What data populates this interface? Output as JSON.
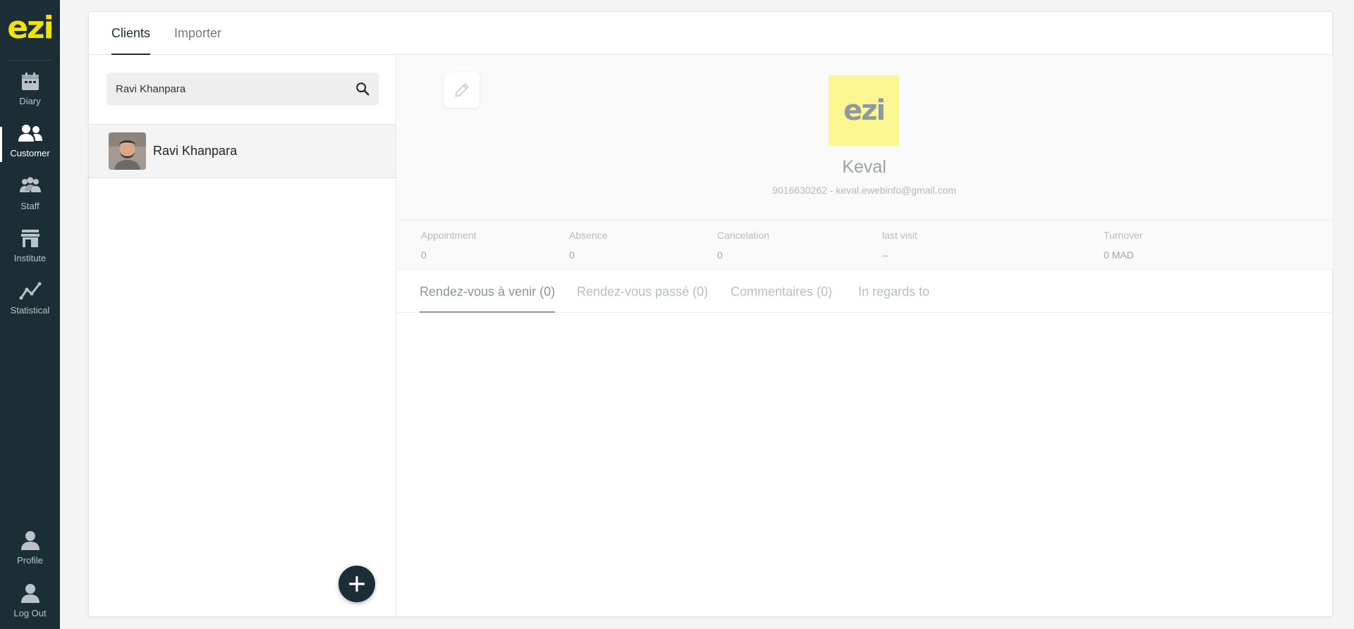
{
  "brand": {
    "logo_text": "ezi",
    "accent": "#f2e300",
    "sidebar_bg": "#1b2e36"
  },
  "sidebar": {
    "items": [
      {
        "label": "Diary",
        "icon": "calendar-icon"
      },
      {
        "label": "Customer",
        "icon": "users-icon",
        "active": true
      },
      {
        "label": "Staff",
        "icon": "staff-icon"
      },
      {
        "label": "Institute",
        "icon": "store-icon"
      },
      {
        "label": "Statistical",
        "icon": "chart-line-icon"
      }
    ],
    "bottom_items": [
      {
        "label": "Profile",
        "icon": "user-icon"
      },
      {
        "label": "Log Out",
        "icon": "logout-user-icon"
      }
    ]
  },
  "top_tabs": [
    {
      "label": "Clients",
      "active": true
    },
    {
      "label": "Importer"
    }
  ],
  "search": {
    "value": "Ravi Khanpara",
    "icon": "search-icon"
  },
  "clients": [
    {
      "name": "Ravi Khanpara",
      "avatar": "avatar-photo"
    }
  ],
  "fab": {
    "icon": "plus-icon"
  },
  "profile": {
    "logo_text": "ezi",
    "name": "Keval",
    "contact": "9016630262 - keval.ewebinfo@gmail.com",
    "edit_icon": "pencil-icon"
  },
  "stats": [
    {
      "label": "Appointment",
      "value": "0"
    },
    {
      "label": "Absence",
      "value": "0"
    },
    {
      "label": "Cancelation",
      "value": "0"
    },
    {
      "label": "last visit",
      "value": "--"
    },
    {
      "label": "Turnover",
      "value": "0 MAD"
    }
  ],
  "detail_tabs": [
    {
      "label": "Rendez-vous à venir (0)",
      "active": true
    },
    {
      "label": "Rendez-vous passé (0)"
    },
    {
      "label": "Commentaires (0)"
    },
    {
      "label": "In regards to"
    }
  ]
}
